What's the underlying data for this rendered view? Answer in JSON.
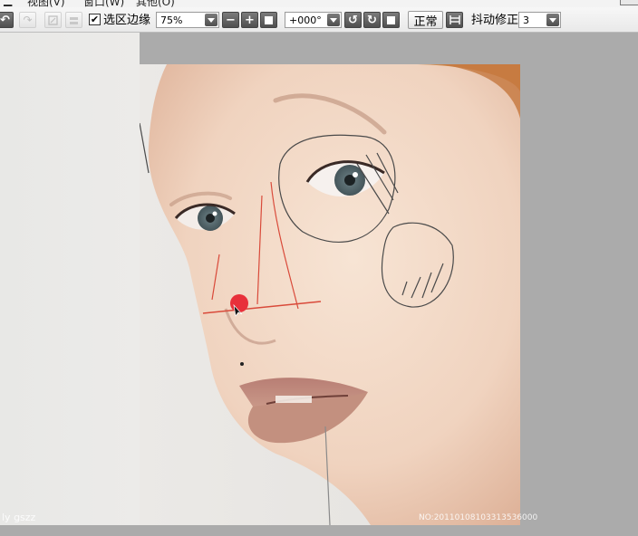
{
  "menubar": {
    "items": [
      "视图(V)",
      "窗口(W)",
      "其他(O)"
    ]
  },
  "toolbar": {
    "select_edge_label": "选区边缘",
    "select_edge_checked": true,
    "zoom_value": "75%",
    "rotation_value": "+000°",
    "blend_mode": "正常",
    "stabilizer_label": "抖动修正",
    "stabilizer_value": "3",
    "icons": [
      "undo-icon",
      "redo-icon",
      "clear-icon",
      "fill-icon",
      "zoom-out-icon",
      "zoom-in-icon",
      "zoom-reset-icon",
      "rotate-left-icon",
      "rotate-right-icon",
      "rotate-reset-icon",
      "flip-horizontal-icon"
    ]
  },
  "canvas": {
    "signature": "ly gszz",
    "image_id": "NO:20110108103313536000",
    "sketch_color": "#4a4a4a",
    "guide_color": "#d94a3a",
    "brush_color": "#e8303a"
  }
}
